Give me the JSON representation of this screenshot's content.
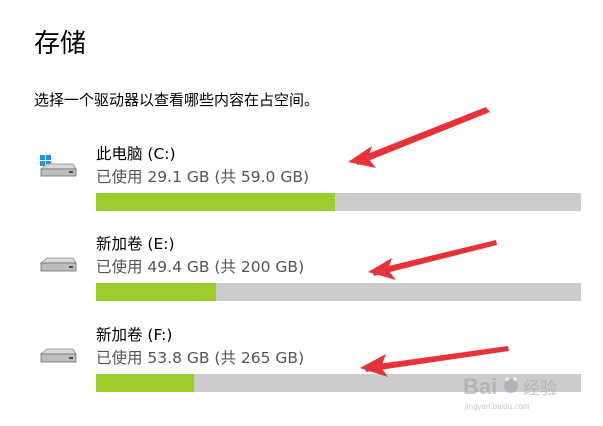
{
  "header": {
    "title": "存储",
    "subtitle": "选择一个驱动器以查看哪些内容在占空间。"
  },
  "drives": [
    {
      "name": "此电脑 (C:)",
      "usage": "已使用 29.1 GB (共 59.0 GB)",
      "used_gb": 29.1,
      "total_gb": 59.0,
      "icon": "windows-system-drive-icon"
    },
    {
      "name": "新加卷 (E:)",
      "usage": "已使用 49.4 GB (共 200 GB)",
      "used_gb": 49.4,
      "total_gb": 200,
      "icon": "hard-drive-icon"
    },
    {
      "name": "新加卷 (F:)",
      "usage": "已使用 53.8 GB (共 265 GB)",
      "used_gb": 53.8,
      "total_gb": 265,
      "icon": "hard-drive-icon"
    }
  ],
  "colors": {
    "bar_fill": "#9ccb2c",
    "bar_track": "#cccccc",
    "annotation_arrow": "#e8323a",
    "watermark": "#9aa0a6"
  },
  "watermark": {
    "brand": "Bai",
    "brand_suffix": "经验",
    "url": "jingyan.baidu.com"
  }
}
